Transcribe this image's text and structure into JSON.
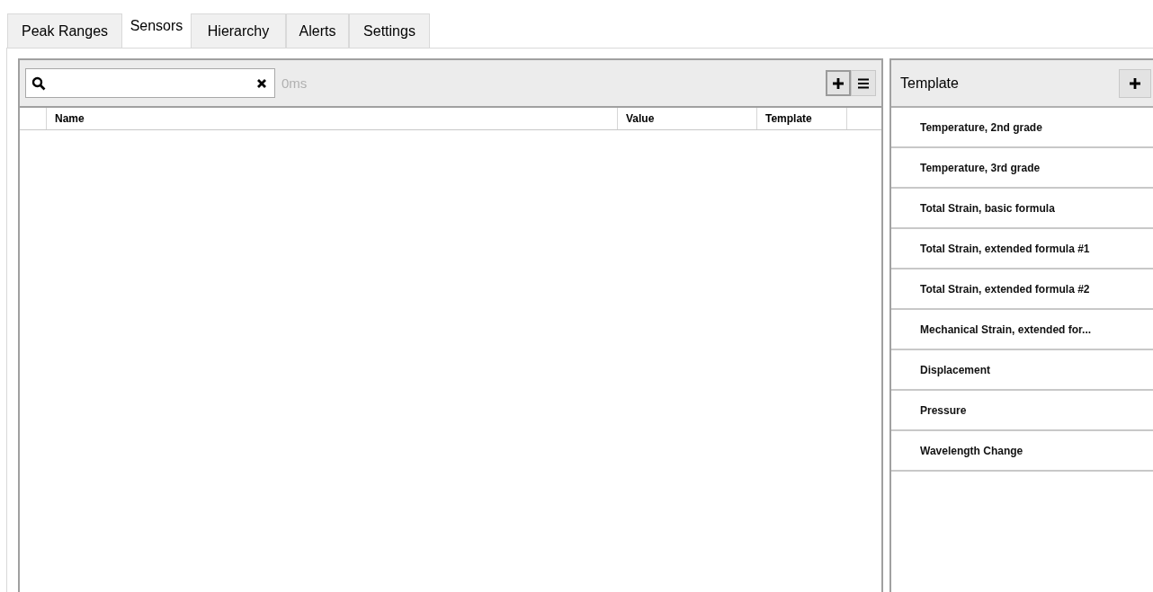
{
  "tabs": [
    {
      "label": "Peak Ranges",
      "selected": false
    },
    {
      "label": "Sensors",
      "selected": true
    },
    {
      "label": "Hierarchy",
      "selected": false
    },
    {
      "label": "Alerts",
      "selected": false
    },
    {
      "label": "Settings",
      "selected": false
    }
  ],
  "search": {
    "timing": "0ms"
  },
  "table": {
    "columns": [
      "Name",
      "Value",
      "Template"
    ]
  },
  "templates": {
    "title": "Template",
    "items": [
      "Temperature, 2nd grade",
      "Temperature, 3rd grade",
      "Total Strain, basic formula",
      "Total Strain, extended formula #1",
      "Total Strain, extended formula #2",
      "Mechanical Strain, extended for...",
      "Displacement",
      "Pressure",
      "Wavelength Change"
    ]
  }
}
